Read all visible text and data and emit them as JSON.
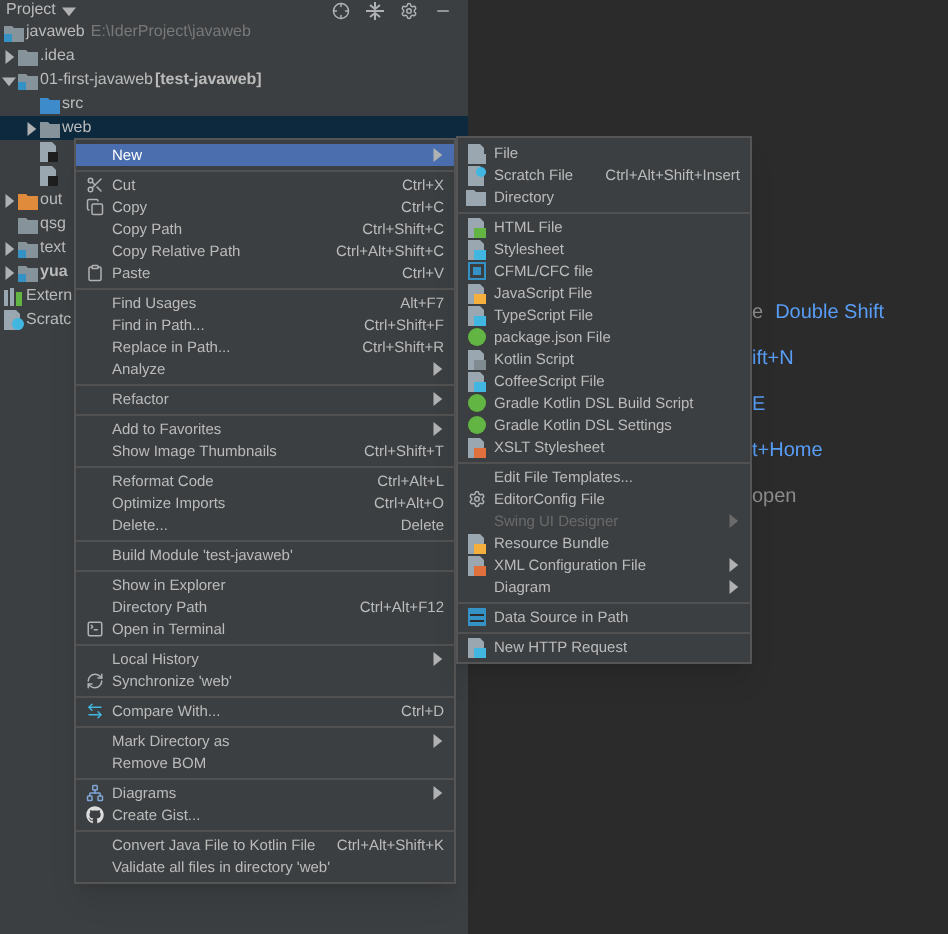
{
  "panel": {
    "title": "Project"
  },
  "tree": [
    {
      "label": "javaweb",
      "path": "E:\\IderProject\\javaweb",
      "kind": "module",
      "selected": false,
      "children": [
        {
          "label": ".idea",
          "kind": "folder",
          "expanded": false,
          "selected": false
        },
        {
          "label": "01-first-javaweb",
          "module": "[test-javaweb]",
          "kind": "module",
          "expanded": true,
          "selected": false,
          "children": [
            {
              "label": "src",
              "kind": "source",
              "selected": false
            },
            {
              "label": "web",
              "kind": "folder",
              "expanded": false,
              "selected": true
            },
            {
              "kind": "file",
              "selected": false
            },
            {
              "kind": "file",
              "selected": false
            }
          ]
        },
        {
          "label": "out",
          "kind": "excluded",
          "expanded": false,
          "selected": false
        },
        {
          "label": "qsg",
          "kind": "folder",
          "selected": false
        },
        {
          "label": "text",
          "kind": "module",
          "expanded": false,
          "selected": false
        },
        {
          "label": "yua",
          "kind": "module",
          "bold": true,
          "expanded": false,
          "selected": false
        }
      ]
    },
    {
      "label": "Extern",
      "kind": "library",
      "selected": false
    },
    {
      "label": "Scratc",
      "kind": "scratch",
      "selected": false
    }
  ],
  "context_menu": [
    {
      "kind": "item",
      "label": "New",
      "submenu": true,
      "selected": true
    },
    {
      "kind": "separator"
    },
    {
      "kind": "item",
      "label": "Cut",
      "shortcut": "Ctrl+X",
      "selected": false
    },
    {
      "kind": "item",
      "label": "Copy",
      "shortcut": "Ctrl+C",
      "selected": false
    },
    {
      "kind": "item",
      "label": "Copy Path",
      "shortcut": "Ctrl+Shift+C",
      "selected": false
    },
    {
      "kind": "item",
      "label": "Copy Relative Path",
      "shortcut": "Ctrl+Alt+Shift+C",
      "selected": false
    },
    {
      "kind": "item",
      "label": "Paste",
      "shortcut": "Ctrl+V",
      "selected": false
    },
    {
      "kind": "separator"
    },
    {
      "kind": "item",
      "label": "Find Usages",
      "shortcut": "Alt+F7",
      "selected": false
    },
    {
      "kind": "item",
      "label": "Find in Path...",
      "shortcut": "Ctrl+Shift+F",
      "selected": false
    },
    {
      "kind": "item",
      "label": "Replace in Path...",
      "shortcut": "Ctrl+Shift+R",
      "selected": false
    },
    {
      "kind": "item",
      "label": "Analyze",
      "submenu": true,
      "selected": false
    },
    {
      "kind": "separator"
    },
    {
      "kind": "item",
      "label": "Refactor",
      "submenu": true,
      "selected": false
    },
    {
      "kind": "separator"
    },
    {
      "kind": "item",
      "label": "Add to Favorites",
      "submenu": true,
      "selected": false
    },
    {
      "kind": "item",
      "label": "Show Image Thumbnails",
      "shortcut": "Ctrl+Shift+T",
      "selected": false
    },
    {
      "kind": "separator"
    },
    {
      "kind": "item",
      "label": "Reformat Code",
      "shortcut": "Ctrl+Alt+L",
      "selected": false
    },
    {
      "kind": "item",
      "label": "Optimize Imports",
      "shortcut": "Ctrl+Alt+O",
      "selected": false
    },
    {
      "kind": "item",
      "label": "Delete...",
      "shortcut": "Delete",
      "selected": false
    },
    {
      "kind": "separator"
    },
    {
      "kind": "item",
      "label": "Build Module 'test-javaweb'",
      "selected": false
    },
    {
      "kind": "separator"
    },
    {
      "kind": "item",
      "label": "Show in Explorer",
      "selected": false
    },
    {
      "kind": "item",
      "label": "Directory Path",
      "shortcut": "Ctrl+Alt+F12",
      "selected": false
    },
    {
      "kind": "item",
      "label": "Open in Terminal",
      "selected": false
    },
    {
      "kind": "separator"
    },
    {
      "kind": "item",
      "label": "Local History",
      "submenu": true,
      "selected": false
    },
    {
      "kind": "item",
      "label": "Synchronize 'web'",
      "selected": false
    },
    {
      "kind": "separator"
    },
    {
      "kind": "item",
      "label": "Compare With...",
      "shortcut": "Ctrl+D",
      "selected": false
    },
    {
      "kind": "separator"
    },
    {
      "kind": "item",
      "label": "Mark Directory as",
      "submenu": true,
      "selected": false
    },
    {
      "kind": "item",
      "label": "Remove BOM",
      "selected": false
    },
    {
      "kind": "separator"
    },
    {
      "kind": "item",
      "label": "Diagrams",
      "submenu": true,
      "selected": false
    },
    {
      "kind": "item",
      "label": "Create Gist...",
      "selected": false
    },
    {
      "kind": "separator"
    },
    {
      "kind": "item",
      "label": "Convert Java File to Kotlin File",
      "shortcut": "Ctrl+Alt+Shift+K",
      "selected": false
    },
    {
      "kind": "item",
      "label": "Validate all files in directory 'web'",
      "selected": false
    }
  ],
  "new_submenu": [
    {
      "kind": "item",
      "label": "File",
      "selected": false,
      "disabled": false
    },
    {
      "kind": "item",
      "label": "Scratch File",
      "shortcut": "Ctrl+Alt+Shift+Insert",
      "selected": false,
      "disabled": false
    },
    {
      "kind": "item",
      "label": "Directory",
      "selected": false,
      "disabled": false
    },
    {
      "kind": "separator"
    },
    {
      "kind": "item",
      "label": "HTML File",
      "selected": false,
      "disabled": false
    },
    {
      "kind": "item",
      "label": "Stylesheet",
      "selected": false,
      "disabled": false
    },
    {
      "kind": "item",
      "label": "CFML/CFC file",
      "selected": false,
      "disabled": false
    },
    {
      "kind": "item",
      "label": "JavaScript File",
      "selected": false,
      "disabled": false
    },
    {
      "kind": "item",
      "label": "TypeScript File",
      "selected": false,
      "disabled": false
    },
    {
      "kind": "item",
      "label": "package.json File",
      "selected": false,
      "disabled": false
    },
    {
      "kind": "item",
      "label": "Kotlin Script",
      "selected": false,
      "disabled": false
    },
    {
      "kind": "item",
      "label": "CoffeeScript File",
      "selected": false,
      "disabled": false
    },
    {
      "kind": "item",
      "label": "Gradle Kotlin DSL Build Script",
      "selected": false,
      "disabled": false
    },
    {
      "kind": "item",
      "label": "Gradle Kotlin DSL Settings",
      "selected": false,
      "disabled": false
    },
    {
      "kind": "item",
      "label": "XSLT Stylesheet",
      "selected": false,
      "disabled": false
    },
    {
      "kind": "separator"
    },
    {
      "kind": "item",
      "label": "Edit File Templates...",
      "selected": false,
      "disabled": false
    },
    {
      "kind": "item",
      "label": "EditorConfig File",
      "selected": false,
      "disabled": false
    },
    {
      "kind": "item",
      "label": "Swing UI Designer",
      "submenu": true,
      "selected": false,
      "disabled": true
    },
    {
      "kind": "item",
      "label": "Resource Bundle",
      "selected": false,
      "disabled": false
    },
    {
      "kind": "item",
      "label": "XML Configuration File",
      "submenu": true,
      "selected": false,
      "disabled": false
    },
    {
      "kind": "item",
      "label": "Diagram",
      "submenu": true,
      "selected": false,
      "disabled": false
    },
    {
      "kind": "separator"
    },
    {
      "kind": "item",
      "label": "Data Source in Path",
      "selected": false,
      "disabled": false
    },
    {
      "kind": "separator"
    },
    {
      "kind": "item",
      "label": "New HTTP Request",
      "selected": false,
      "disabled": false
    }
  ],
  "editor_hints": [
    {
      "parts": [
        {
          "text": "e",
          "kind": "label"
        },
        {
          "text": "Double Shift",
          "kind": "shortcut"
        }
      ]
    },
    {
      "parts": [
        {
          "text": "ift+N",
          "kind": "shortcut"
        }
      ]
    },
    {
      "parts": [
        {
          "text": "E",
          "kind": "shortcut"
        }
      ]
    },
    {
      "parts": [
        {
          "text": "t+Home",
          "kind": "shortcut"
        }
      ]
    },
    {
      "parts": [
        {
          "text": "open",
          "kind": "label"
        }
      ]
    }
  ]
}
